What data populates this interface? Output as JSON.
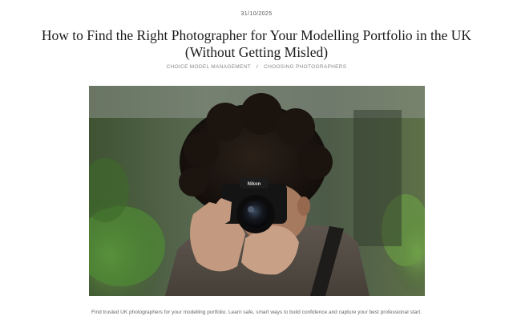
{
  "post": {
    "date": "31/10/2025",
    "title_line1": "How to Find the Right Photographer for Your Modelling Portfolio in the UK",
    "title_line2": "(Without Getting Misled)",
    "categories": [
      "CHOICE MODEL MANAGEMENT",
      "CHOOSING PHOTOGRAPHERS"
    ],
    "category_separator": "/",
    "excerpt": "Find trusted UK photographers for your modelling portfolio. Learn safe, smart ways to build confidence and capture your best professional start."
  },
  "image": {
    "camera_brand": "Nikon"
  },
  "colors": {
    "title": "#1b1b1b",
    "meta": "#8a8a8a",
    "excerpt": "#666666"
  }
}
